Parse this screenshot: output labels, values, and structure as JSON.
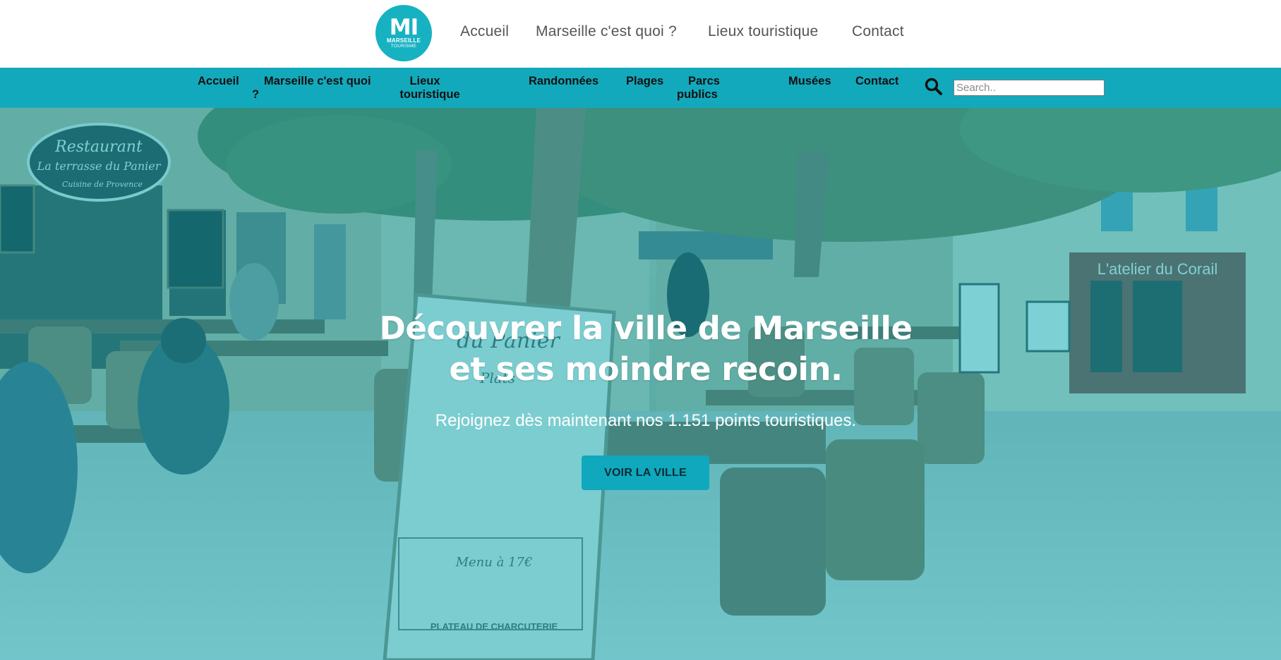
{
  "logo": {
    "mark": "MI",
    "line1": "MARSEILLE",
    "line2": "TOURISME",
    "color": "#16b2c2"
  },
  "top_nav": [
    "Accueil",
    "Marseille c'est quoi ?",
    "Lieux touristique",
    "Contact"
  ],
  "main_nav": {
    "items": [
      {
        "lines": [
          "Accueil"
        ]
      },
      {
        "lines": [
          "Marseille c'est quoi",
          "?"
        ]
      },
      {
        "lines": [
          "Lieux",
          "touristique"
        ]
      },
      {
        "lines": [
          "Randonnées"
        ]
      },
      {
        "lines": [
          "Plages"
        ]
      },
      {
        "lines": [
          "Parcs",
          "publics"
        ]
      },
      {
        "lines": [
          "Musées"
        ]
      },
      {
        "lines": [
          "Contact"
        ]
      }
    ],
    "bar_color": "#13a9bc",
    "search_icon": "search-icon",
    "search_placeholder": "Search.."
  },
  "hero": {
    "title_line1": "Découvrer la ville de Marseille",
    "title_line2": "et ses moindre recoin.",
    "subtitle": "Rejoignez dès maintenant nos 1.151 points touristiques.",
    "button_label": "VOIR LA VILLE",
    "overlay_color": "#0cb2c0",
    "background_scene": "cafe terrace with tables, chairs, menu board and plane trees",
    "signs": {
      "restaurant": "Restaurant",
      "restaurant_name": "La terrasse du Panier",
      "restaurant_sub": "Cuisine de Provence",
      "shop": "L'atelier du Corail",
      "menu_top": "du Panier",
      "menu_section": "Plats",
      "menu_price": "Menu à 17€",
      "menu_footer": "PLATEAU DE CHARCUTERIE"
    }
  }
}
